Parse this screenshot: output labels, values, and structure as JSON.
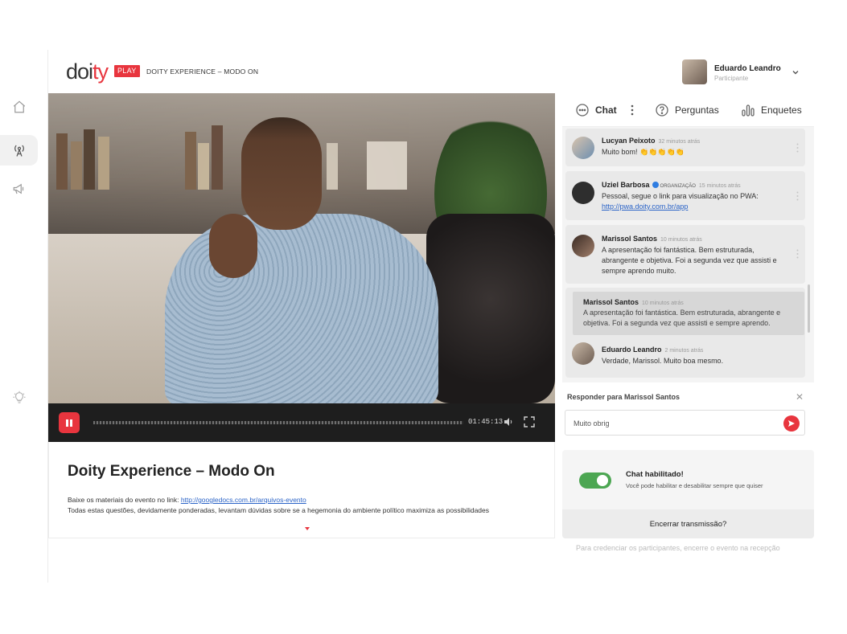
{
  "header": {
    "logo_main": "doi",
    "logo_accent": "ty",
    "logo_badge": "PLAY",
    "event_name": "DOITY EXPERIENCE – MODO ON",
    "user_name": "Eduardo Leandro",
    "user_role": "Participante"
  },
  "sidebar": {
    "items": [
      {
        "icon": "home-icon"
      },
      {
        "icon": "broadcast-icon",
        "active": true
      },
      {
        "icon": "megaphone-icon"
      },
      {
        "icon": "lightbulb-icon"
      }
    ]
  },
  "player": {
    "time": "01:45:13",
    "state": "playing"
  },
  "description": {
    "title": "Doity Experience – Modo On",
    "line1_prefix": "Baixe os materiais do evento no link: ",
    "line1_link": "http://googledocs.com.br/arquivos-evento",
    "line2": "Todas estas questões, devidamente ponderadas, levantam dúvidas sobre se a hegemonia do ambiente político maximiza as possibilidades"
  },
  "chat_panel": {
    "tabs": [
      {
        "label": "Chat",
        "icon": "chat-icon",
        "active": true
      },
      {
        "label": "Perguntas",
        "icon": "question-icon"
      },
      {
        "label": "Enquetes",
        "icon": "poll-icon"
      }
    ],
    "messages": [
      {
        "author": "Lucyan Peixoto",
        "time": "32 minutos atrás",
        "text": "Muito bom! 👏👏👏👏👏"
      },
      {
        "author": "Uziel Barbosa",
        "badge": "ORGANIZAÇÃO",
        "time": "15 minutos atrás",
        "text": "Pessoal, segue o link para visualização no PWA:",
        "link": "http://pwa.doity.com.br/app"
      },
      {
        "author": "Marissol Santos",
        "time": "10 minutos atrás",
        "text": "A apresentação foi fantástica. Bem estruturada, abrangente e objetiva. Foi a segunda vez que assisti e sempre aprendo muito."
      },
      {
        "quote_author": "Marissol Santos",
        "quote_time": "10 minutos atrás",
        "quote_text": "A apresentação foi fantástica. Bem estruturada, abrangente e objetiva. Foi a segunda vez que assisti e sempre aprendo.",
        "author": "Eduardo Leandro",
        "time": "2 minutos atrás",
        "text": "Verdade, Marissol. Muito boa mesmo."
      }
    ],
    "reply_label": "Responder para Marissol Santos",
    "input_value": "Muito obrig"
  },
  "chat_settings": {
    "toggle_title": "Chat habilitado!",
    "toggle_sub": "Você pode habilitar e desabilitar sempre que quiser",
    "toggle_on": true,
    "end_label": "Encerrar transmissão?",
    "footnote": "Para credenciar os participantes, encerre o evento na recepção"
  },
  "colors": {
    "accent": "#e8353e",
    "toggle_on": "#4ca652",
    "link": "#2a63c7"
  }
}
